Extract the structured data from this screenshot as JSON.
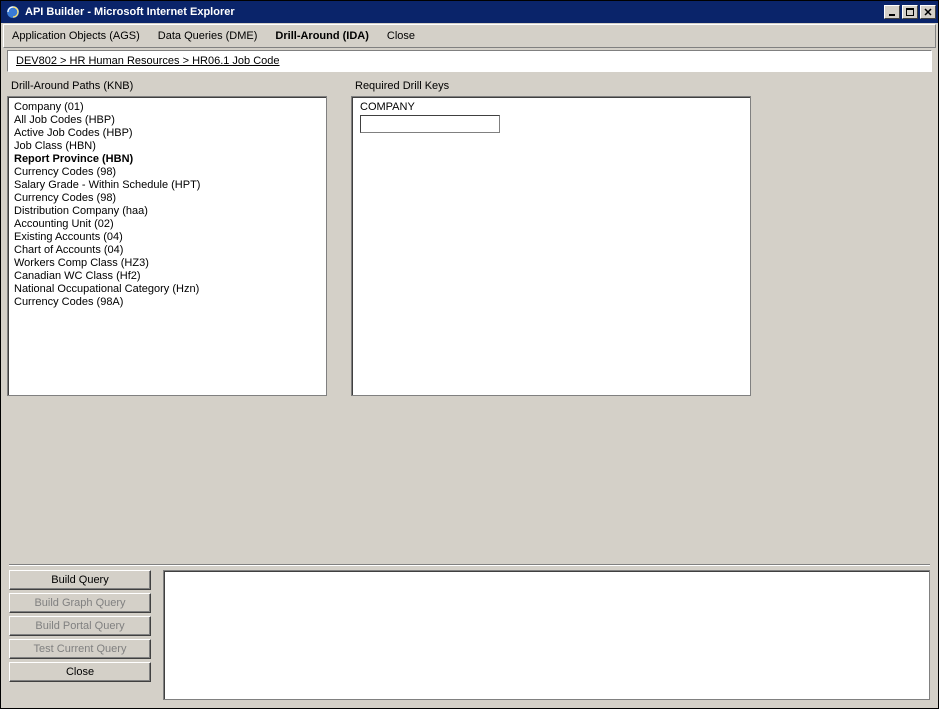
{
  "window": {
    "title": "API Builder - Microsoft Internet Explorer"
  },
  "menubar": {
    "items": [
      {
        "label": "Application Objects (AGS)",
        "active": false
      },
      {
        "label": "Data Queries (DME)",
        "active": false
      },
      {
        "label": "Drill-Around (IDA)",
        "active": true
      },
      {
        "label": "Close",
        "active": false
      }
    ]
  },
  "breadcrumb": {
    "text": "DEV802 > HR Human Resources > HR06.1 Job Code"
  },
  "paths": {
    "label": "Drill-Around Paths (KNB)",
    "items": [
      {
        "label": "Company (01)",
        "selected": false
      },
      {
        "label": "All Job Codes (HBP)",
        "selected": false
      },
      {
        "label": "Active Job Codes (HBP)",
        "selected": false
      },
      {
        "label": "Job Class (HBN)",
        "selected": false
      },
      {
        "label": "Report Province (HBN)",
        "selected": true
      },
      {
        "label": "Currency Codes (98)",
        "selected": false
      },
      {
        "label": "Salary Grade - Within Schedule (HPT)",
        "selected": false
      },
      {
        "label": "Currency Codes (98)",
        "selected": false
      },
      {
        "label": "Distribution Company (haa)",
        "selected": false
      },
      {
        "label": "Accounting Unit (02)",
        "selected": false
      },
      {
        "label": "Existing Accounts (04)",
        "selected": false
      },
      {
        "label": "Chart of Accounts (04)",
        "selected": false
      },
      {
        "label": "Workers Comp Class (HZ3)",
        "selected": false
      },
      {
        "label": "Canadian WC Class (Hf2)",
        "selected": false
      },
      {
        "label": "National Occupational Category (Hzn)",
        "selected": false
      },
      {
        "label": "Currency Codes (98A)",
        "selected": false
      }
    ]
  },
  "drillKeys": {
    "label": "Required Drill Keys",
    "fields": [
      {
        "label": "COMPANY",
        "value": ""
      }
    ]
  },
  "buttons": {
    "build": "Build Query",
    "buildGraph": "Build Graph Query",
    "buildPortal": "Build Portal Query",
    "testCurrent": "Test Current Query",
    "close": "Close"
  },
  "queryOutput": ""
}
